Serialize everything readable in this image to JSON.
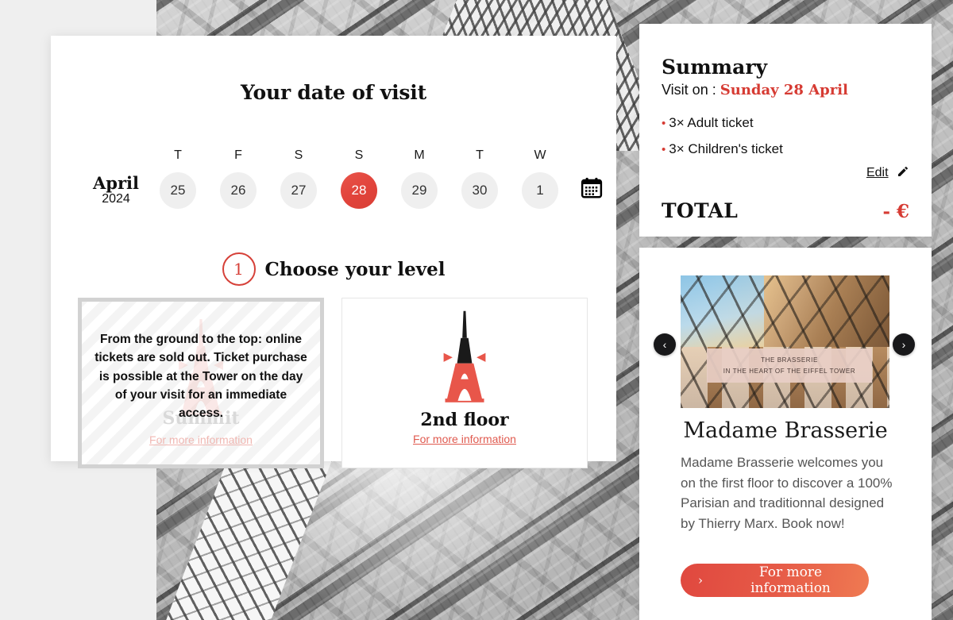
{
  "background": {
    "description": "grayscale-eiffel-tower-structure-photo"
  },
  "booking": {
    "title": "Your date of visit",
    "calendar": {
      "month": "April",
      "year": "2024",
      "icon": "calendar-icon",
      "days": [
        {
          "dow": "T",
          "num": "25",
          "selected": false
        },
        {
          "dow": "F",
          "num": "26",
          "selected": false
        },
        {
          "dow": "S",
          "num": "27",
          "selected": false
        },
        {
          "dow": "S",
          "num": "28",
          "selected": true
        },
        {
          "dow": "M",
          "num": "29",
          "selected": false
        },
        {
          "dow": "T",
          "num": "30",
          "selected": false
        },
        {
          "dow": "W",
          "num": "1",
          "selected": false
        }
      ]
    },
    "step": {
      "number": "1",
      "title": "Choose your level"
    },
    "levels": [
      {
        "state": "sold-out",
        "ghost_label": "Summit",
        "message": "From the ground to the top: online tickets are sold out. Ticket purchase is possible at the Tower on the day of your visit for an immediate access.",
        "link": "For more information"
      },
      {
        "state": "available",
        "name": "2nd floor",
        "link": "For more information"
      }
    ]
  },
  "summary": {
    "heading": "Summary",
    "visit_label": "Visit on :",
    "visit_date": "Sunday 28 April",
    "tickets": [
      {
        "bullet": "•",
        "text": "3× Adult ticket"
      },
      {
        "bullet": "•",
        "text": "3× Children's ticket"
      }
    ],
    "edit_label": "Edit",
    "total_label": "TOTAL",
    "total_value": "- €"
  },
  "promo": {
    "image_caption_line1": "THE BRASSERIE",
    "image_caption_line2": "IN THE HEART OF THE EIFFEL TOWER",
    "title": "Madame Brasserie",
    "description": "Madame Brasserie welcomes you on the first floor to discover a 100% Parisian and traditionnal designed by Thierry Marx. Book now!",
    "button_label": "For more information",
    "button_chevron": "›",
    "prev_arrow": "‹",
    "next_arrow": "›"
  },
  "colors": {
    "accent_red": "#d63b33",
    "accent_coral": "#e65a47",
    "muted_gray": "#d2d2d2",
    "text_dark": "#111111"
  }
}
